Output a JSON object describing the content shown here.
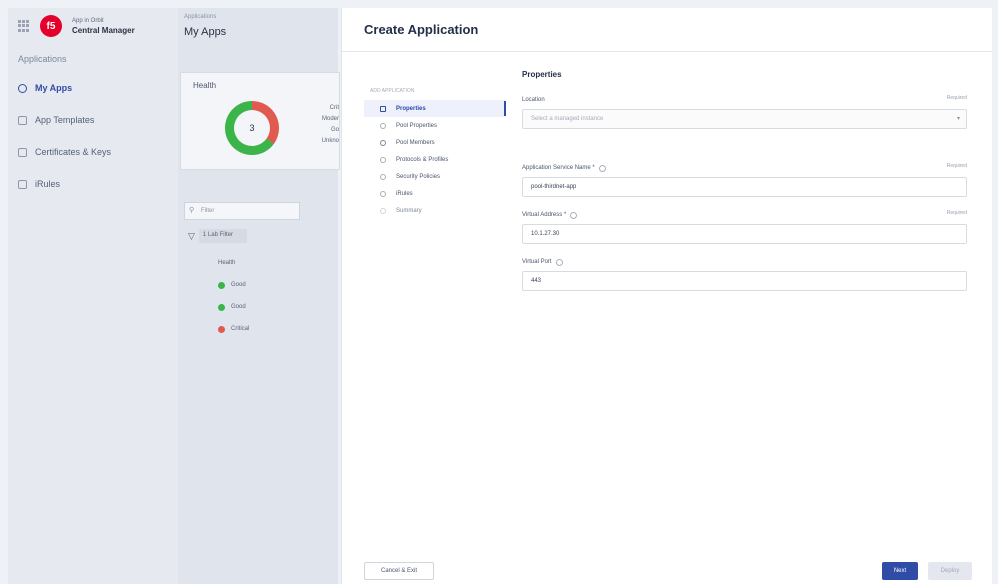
{
  "background_app": {
    "brand_small": "App in Orbit",
    "brand_name": "Central Manager",
    "section": "Applications",
    "nav": [
      {
        "label": "My Apps",
        "icon": "apps-icon",
        "active": true
      },
      {
        "label": "App Templates",
        "icon": "template-icon"
      },
      {
        "label": "Certificates & Keys",
        "icon": "certificate-icon"
      },
      {
        "label": "iRules",
        "icon": "irules-icon"
      }
    ],
    "breadcrumb": "Applications",
    "title": "My Apps",
    "health_card": {
      "title": "Health",
      "total": "3",
      "legend": [
        "Crit",
        "Moder",
        "Go",
        "Unkno"
      ]
    },
    "filter_placeholder": "Filter",
    "filter_tag": "1 Lab Filter",
    "health_rows": [
      {
        "label": "Good",
        "color": "#3bb54a"
      },
      {
        "label": "Good",
        "color": "#3bb54a"
      },
      {
        "label": "Critical",
        "color": "#e05a4f"
      }
    ],
    "health_column": "Health"
  },
  "modal": {
    "title": "Create Application",
    "steps_caption": "ADD APPLICATION",
    "steps": [
      {
        "label": "Properties",
        "state": "active"
      },
      {
        "label": "Pool Properties",
        "state": "done"
      },
      {
        "label": "Pool Members",
        "state": "pending"
      },
      {
        "label": "Protocols & Profiles",
        "state": "done"
      },
      {
        "label": "Security Policies",
        "state": "done"
      },
      {
        "label": "iRules",
        "state": "done"
      },
      {
        "label": "Summary",
        "state": "future"
      }
    ],
    "form": {
      "section_title": "Properties",
      "location": {
        "label": "Location",
        "required": "Required",
        "placeholder": "Select a managed instance"
      },
      "service_name": {
        "label": "Application Service Name *",
        "required": "Required",
        "value": "pool-thirdnet-app"
      },
      "virtual_address": {
        "label": "Virtual Address *",
        "required": "Required",
        "value": "10.1.27.30"
      },
      "virtual_port": {
        "label": "Virtual Port",
        "value": "443"
      }
    },
    "footer": {
      "cancel": "Cancel & Exit",
      "next": "Next",
      "deploy": "Deploy"
    }
  },
  "colors": {
    "accent": "#2f4da6",
    "good": "#3bb54a",
    "critical": "#e05a4f"
  }
}
